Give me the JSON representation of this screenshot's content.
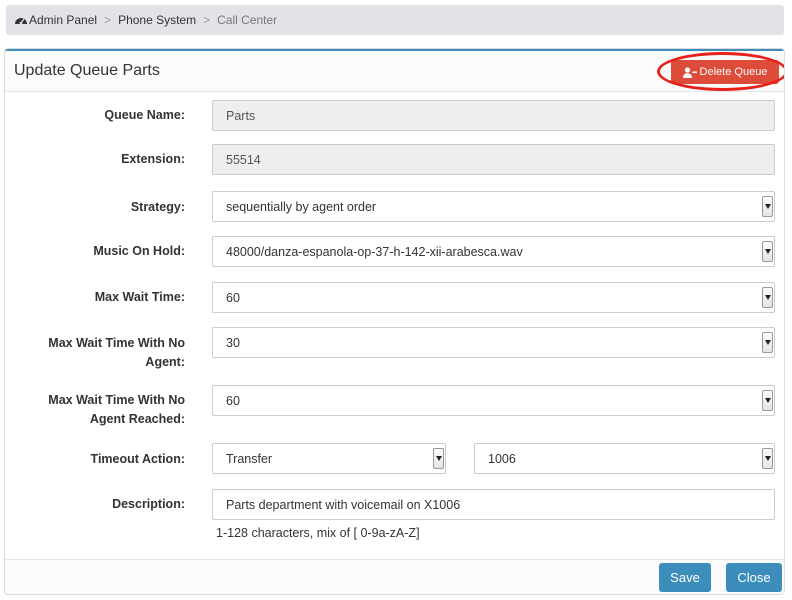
{
  "breadcrumb": {
    "items": [
      "Admin Panel",
      "Phone System",
      "Call Center"
    ],
    "separator": ">"
  },
  "header": {
    "title": "Update Queue Parts",
    "delete_label": "Delete Queue",
    "delete_icon": "user-minus-icon"
  },
  "form": {
    "queue_name": {
      "label": "Queue Name:",
      "value": "Parts"
    },
    "extension": {
      "label": "Extension:",
      "value": "55514"
    },
    "strategy": {
      "label": "Strategy:",
      "value": "sequentially by agent order"
    },
    "music_on_hold": {
      "label": "Music On Hold:",
      "value": "48000/danza-espanola-op-37-h-142-xii-arabesca.wav"
    },
    "max_wait_time": {
      "label": "Max Wait Time:",
      "value": "60"
    },
    "max_wait_no_agent": {
      "label_line1": "Max Wait Time With No",
      "label_line2": "Agent:",
      "value": "30"
    },
    "max_wait_no_agent_reached": {
      "label_line1": "Max Wait Time With No",
      "label_line2": "Agent Reached:",
      "value": "60"
    },
    "timeout_action": {
      "label": "Timeout Action:",
      "action_value": "Transfer",
      "target_value": "1006"
    },
    "description": {
      "label": "Description:",
      "value": "Parts department with voicemail on X1006",
      "help": "1-128 characters, mix of [ 0-9a-zA-Z]"
    }
  },
  "footer": {
    "save_label": "Save",
    "close_label": "Close"
  },
  "colors": {
    "primary": "#3c8dbc",
    "danger": "#dd4b39",
    "highlight": "#e8201a"
  }
}
